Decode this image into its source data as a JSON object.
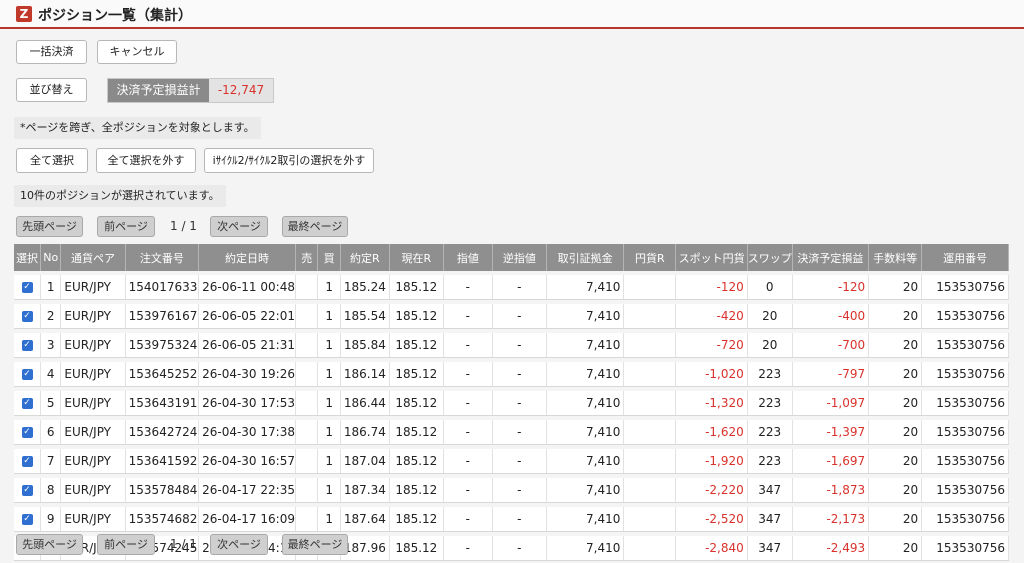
{
  "header": {
    "logo": "Z",
    "title": "ポジション一覧（集計）"
  },
  "buttons": {
    "bulk_settle": "一括決済",
    "cancel": "キャンセル",
    "sort": "並び替え",
    "select_all": "全て選択",
    "deselect_all": "全て選択を外す",
    "deselect_icycle": "iｻｲｸﾙ2/ｻｲｸﾙ2取引の選択を外す"
  },
  "summary": {
    "label": "決済予定損益計",
    "value": "-12,747"
  },
  "notes": {
    "cross_page": "*ページを跨ぎ、全ポジションを対象とします。",
    "selected_count": "10件のポジションが選択されています。"
  },
  "pager": {
    "first": "先頭ページ",
    "prev": "前ページ",
    "page": "1 / 1",
    "next": "次ページ",
    "last": "最終ページ"
  },
  "colors": {
    "accent": "#b8352c",
    "negative": "#d9312b",
    "checkbox": "#2f6fd0"
  },
  "table": {
    "columns": [
      "選択",
      "No",
      "通貨ペア",
      "注文番号",
      "約定日時",
      "売",
      "買",
      "約定R",
      "現在R",
      "指値",
      "逆指値",
      "取引証拠金",
      "円貨R",
      "スポット円貨",
      "スワップ",
      "決済予定損益",
      "手数料等",
      "運用番号"
    ],
    "rows": [
      [
        "1",
        "EUR/JPY",
        "154017633",
        "26-06-11 00:48",
        "",
        "1",
        "185.24",
        "185.12",
        "-",
        "-",
        "7,410",
        "",
        "-120",
        "0",
        "-120",
        "20",
        "153530756"
      ],
      [
        "2",
        "EUR/JPY",
        "153976167",
        "26-06-05 22:01",
        "",
        "1",
        "185.54",
        "185.12",
        "-",
        "-",
        "7,410",
        "",
        "-420",
        "20",
        "-400",
        "20",
        "153530756"
      ],
      [
        "3",
        "EUR/JPY",
        "153975324",
        "26-06-05 21:31",
        "",
        "1",
        "185.84",
        "185.12",
        "-",
        "-",
        "7,410",
        "",
        "-720",
        "20",
        "-700",
        "20",
        "153530756"
      ],
      [
        "4",
        "EUR/JPY",
        "153645252",
        "26-04-30 19:26",
        "",
        "1",
        "186.14",
        "185.12",
        "-",
        "-",
        "7,410",
        "",
        "-1,020",
        "223",
        "-797",
        "20",
        "153530756"
      ],
      [
        "5",
        "EUR/JPY",
        "153643191",
        "26-04-30 17:53",
        "",
        "1",
        "186.44",
        "185.12",
        "-",
        "-",
        "7,410",
        "",
        "-1,320",
        "223",
        "-1,097",
        "20",
        "153530756"
      ],
      [
        "6",
        "EUR/JPY",
        "153642724",
        "26-04-30 17:38",
        "",
        "1",
        "186.74",
        "185.12",
        "-",
        "-",
        "7,410",
        "",
        "-1,620",
        "223",
        "-1,397",
        "20",
        "153530756"
      ],
      [
        "7",
        "EUR/JPY",
        "153641592",
        "26-04-30 16:57",
        "",
        "1",
        "187.04",
        "185.12",
        "-",
        "-",
        "7,410",
        "",
        "-1,920",
        "223",
        "-1,697",
        "20",
        "153530756"
      ],
      [
        "8",
        "EUR/JPY",
        "153578484",
        "26-04-17 22:35",
        "",
        "1",
        "187.34",
        "185.12",
        "-",
        "-",
        "7,410",
        "",
        "-2,220",
        "347",
        "-1,873",
        "20",
        "153530756"
      ],
      [
        "9",
        "EUR/JPY",
        "153574682",
        "26-04-17 16:09",
        "",
        "1",
        "187.64",
        "185.12",
        "-",
        "-",
        "7,410",
        "",
        "-2,520",
        "347",
        "-2,173",
        "20",
        "153530756"
      ],
      [
        "10",
        "EUR/JPY",
        "153574245",
        "26-04-17 14:14",
        "",
        "1",
        "187.96",
        "185.12",
        "-",
        "-",
        "7,410",
        "",
        "-2,840",
        "347",
        "-2,493",
        "20",
        "153530756"
      ]
    ]
  }
}
